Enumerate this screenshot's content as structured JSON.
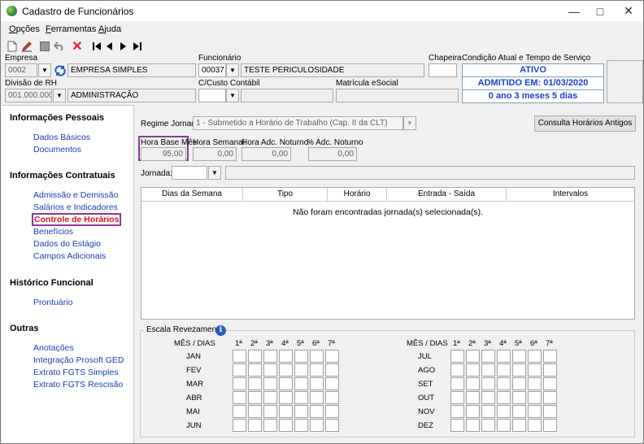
{
  "window": {
    "title": "Cadastro de Funcionários"
  },
  "menu": [
    {
      "label": "Opções",
      "u": "O",
      "rest": "pções"
    },
    {
      "label": "Ferramentas",
      "u": "F",
      "rest": "erramentas"
    },
    {
      "label": "Ajuda",
      "u": "A",
      "rest": "juda"
    }
  ],
  "header": {
    "empresa_label": "Empresa",
    "empresa_code": "0002",
    "empresa_name": "EMPRESA SIMPLES",
    "funcionario_label": "Funcionário",
    "funcionario_code": "00037",
    "funcionario_name": "TESTE PERICULOSIDADE",
    "chapeira_label": "Chapeira",
    "chapeira_value": "",
    "condicao_label": "Condição Atual e Tempo de Serviço",
    "status_ativo": "ATIVO",
    "status_admitido": "ADMITIDO EM: 01/03/2020",
    "status_tempo": "0 ano 3 meses 5 dias",
    "divisao_label": "Divisão de RH",
    "divisao_code": "001.000.000",
    "divisao_name": "ADMINISTRAÇÃO",
    "custo_label": "C/Custo Contábil",
    "custo_value": "",
    "matricula_label": "Matrícula eSocial",
    "matricula_value": ""
  },
  "sidebar": {
    "pessoais_title": "Informações Pessoais",
    "pessoais": [
      "Dados Básicos",
      "Documentos"
    ],
    "contratuais_title": "Informações Contratuais",
    "contratuais": [
      "Admissão e Demissão",
      "Salários e Indicadores",
      "Controle de Horários",
      "Benefícios",
      "Dados do Estágio",
      "Campos Adicionais"
    ],
    "historico_title": "Histórico Funcional",
    "historico": [
      "Prontuário"
    ],
    "outras_title": "Outras",
    "outras": [
      "Anotações",
      "Integração Prosoft GED",
      "Extrato FGTS Simples",
      "Extrato FGTS Rescisão"
    ]
  },
  "main": {
    "regime_label": "Regime Jornada",
    "regime_value": "1 - Submetido a Horário de Trabalho (Cap. II da CLT)",
    "consulta_button": "Consulta Horários Antigos",
    "hora_base_label": "Hora Base Mês",
    "hora_base_value": "95,00",
    "hora_semanal_label": "Hora Semanal",
    "hora_semanal_value": "0,00",
    "hora_adc_label": "Hora Adc. Noturno",
    "hora_adc_value": "0,00",
    "pct_adc_label": "% Adc. Noturno",
    "pct_adc_value": "0,00",
    "jornada_label": "Jornada:",
    "jornada_code": "",
    "jornada_desc": "",
    "grid_headers": [
      "Dias da Semana",
      "Tipo",
      "Horário",
      "Entrada - Saída",
      "Intervalos"
    ],
    "grid_empty": "Não foram encontradas jornada(s) selecionada(s).",
    "escala_title": "Escala Revezamento",
    "mes_dias": "MÊS / DIAS",
    "day_headers": [
      "1ª",
      "2ª",
      "3ª",
      "4ª",
      "5ª",
      "6ª",
      "7ª"
    ],
    "months_left": [
      "JAN",
      "FEV",
      "MAR",
      "ABR",
      "MAI",
      "JUN"
    ],
    "months_right": [
      "JUL",
      "AGO",
      "SET",
      "OUT",
      "NOV",
      "DEZ"
    ]
  }
}
